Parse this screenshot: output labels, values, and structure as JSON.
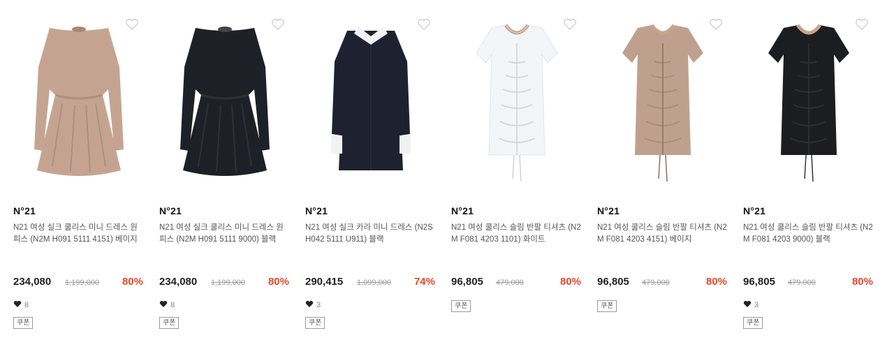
{
  "products": [
    {
      "brand": "N°21",
      "name": "N21 여성 실크 쿨리스 미니 드레스 원피스 (N2M H091 5111 4151) 베이지",
      "price": "234,080",
      "original_price": "1,199,000",
      "discount": "80%",
      "likes": "8",
      "coupon": "쿠폰",
      "color": "#c4a491",
      "style": "flared-long"
    },
    {
      "brand": "N°21",
      "name": "N21 여성 실크 쿨리스 미니 드레스 원피스 (N2M H091 5111 9000) 블랙",
      "price": "234,080",
      "original_price": "1,199,000",
      "discount": "80%",
      "likes": "8",
      "coupon": "쿠폰",
      "color": "#1e2028",
      "style": "flared-long"
    },
    {
      "brand": "N°21",
      "name": "N21 여성 실크 카라 미니 드레스 (N2S H042 5111 U911) 블랙",
      "price": "290,415",
      "original_price": "1,099,000",
      "discount": "74%",
      "likes": "3",
      "coupon": "쿠폰",
      "color": "#1e2230",
      "style": "collar-long"
    },
    {
      "brand": "N°21",
      "name": "N21 여성 쿨리스 슬림 반팔 티셔츠 (N2M F081 4203 1101) 화이트",
      "price": "96,805",
      "original_price": "479,000",
      "discount": "80%",
      "likes": "",
      "coupon": "쿠폰",
      "color": "#f4f5f7",
      "style": "tee-ruched"
    },
    {
      "brand": "N°21",
      "name": "N21 여성 쿨리스 슬림 반팔 티셔츠 (N2M F081 4203 4151) 베이지",
      "price": "96,805",
      "original_price": "479,000",
      "discount": "80%",
      "likes": "",
      "coupon": "쿠폰",
      "color": "#bfa08f",
      "style": "tee-ruched"
    },
    {
      "brand": "N°21",
      "name": "N21 여성 쿨리스 슬림 반팔 티셔츠 (N2M F081 4203 9000) 블랙",
      "price": "96,805",
      "original_price": "479,000",
      "discount": "80%",
      "likes": "3",
      "coupon": "쿠폰",
      "color": "#1c1d20",
      "style": "tee-ruched"
    }
  ],
  "colors": {
    "discount": "#e8472b",
    "strikethrough": "#999999",
    "heart_outline": "#cccccc"
  },
  "icons": {
    "wish": "heart-outline-icon",
    "like": "heart-filled-icon"
  }
}
